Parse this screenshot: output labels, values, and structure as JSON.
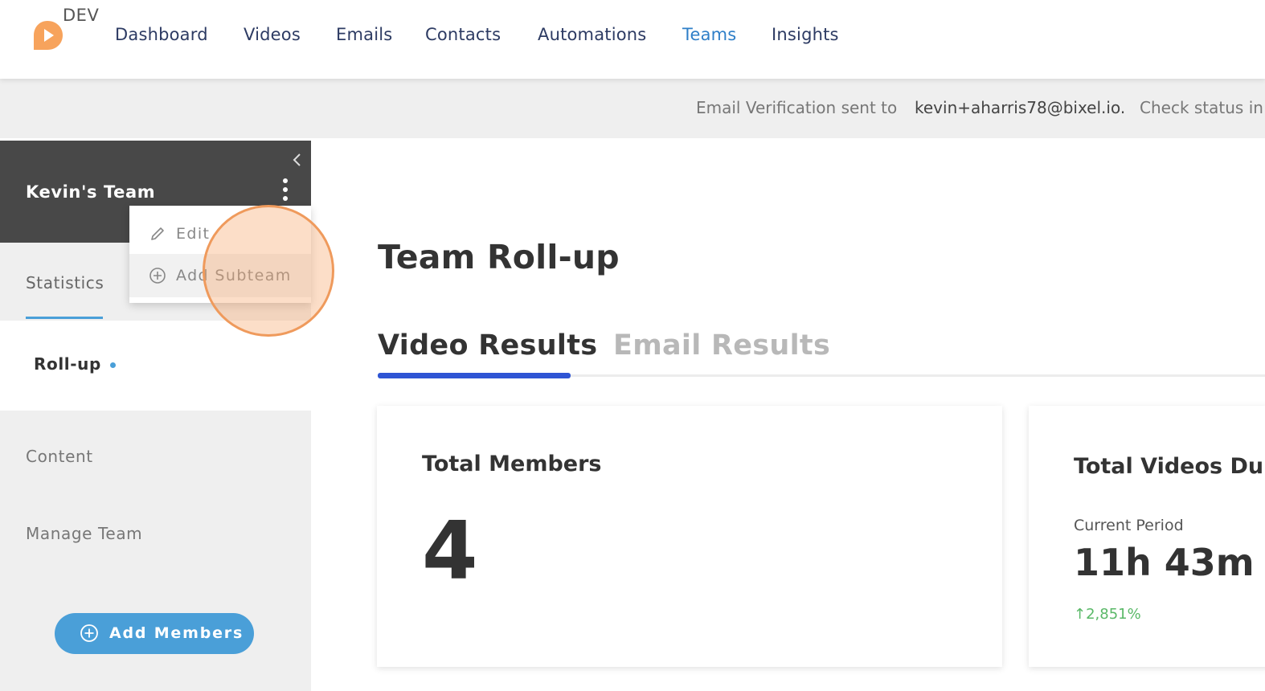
{
  "header": {
    "env_label": "DEV",
    "nav": [
      {
        "label": "Dashboard"
      },
      {
        "label": "Videos"
      },
      {
        "label": "Emails"
      },
      {
        "label": "Contacts"
      },
      {
        "label": "Automations"
      },
      {
        "label": "Teams",
        "active": true
      },
      {
        "label": "Insights"
      }
    ]
  },
  "banner": {
    "text": "Email Verification sent to",
    "email": "kevin+aharris78@bixel.io.",
    "check": "Check status in"
  },
  "sidebar": {
    "team_name": "Kevin's Team",
    "collapse_icon": "chevron-left-icon",
    "menu_icon": "kebab-vertical-icon",
    "statistics_label": "Statistics",
    "rollup_label": "Roll-up",
    "content_label": "Content",
    "manage_team_label": "Manage Team",
    "add_members_label": "Add Members",
    "accent_color": "#4a9fd8"
  },
  "dropdown": {
    "items": [
      {
        "label": "Edit",
        "icon": "pencil-icon"
      },
      {
        "label": "Add Subteam",
        "icon": "plus-circle-icon"
      }
    ]
  },
  "main": {
    "title": "Team Roll-up",
    "tabs": [
      {
        "label": "Video Results",
        "active": true
      },
      {
        "label": "Email Results",
        "active": false
      }
    ],
    "cards": [
      {
        "title": "Total Members",
        "value": "4"
      },
      {
        "title": "Total Videos Dur",
        "period_label": "Current Period",
        "value": "11h 43m",
        "change": "↑2,851%"
      }
    ]
  },
  "colors": {
    "brand_orange": "#f7a35c",
    "nav_active": "#2f7fc8",
    "tab_underline": "#2f55d4",
    "positive": "#59b867"
  }
}
